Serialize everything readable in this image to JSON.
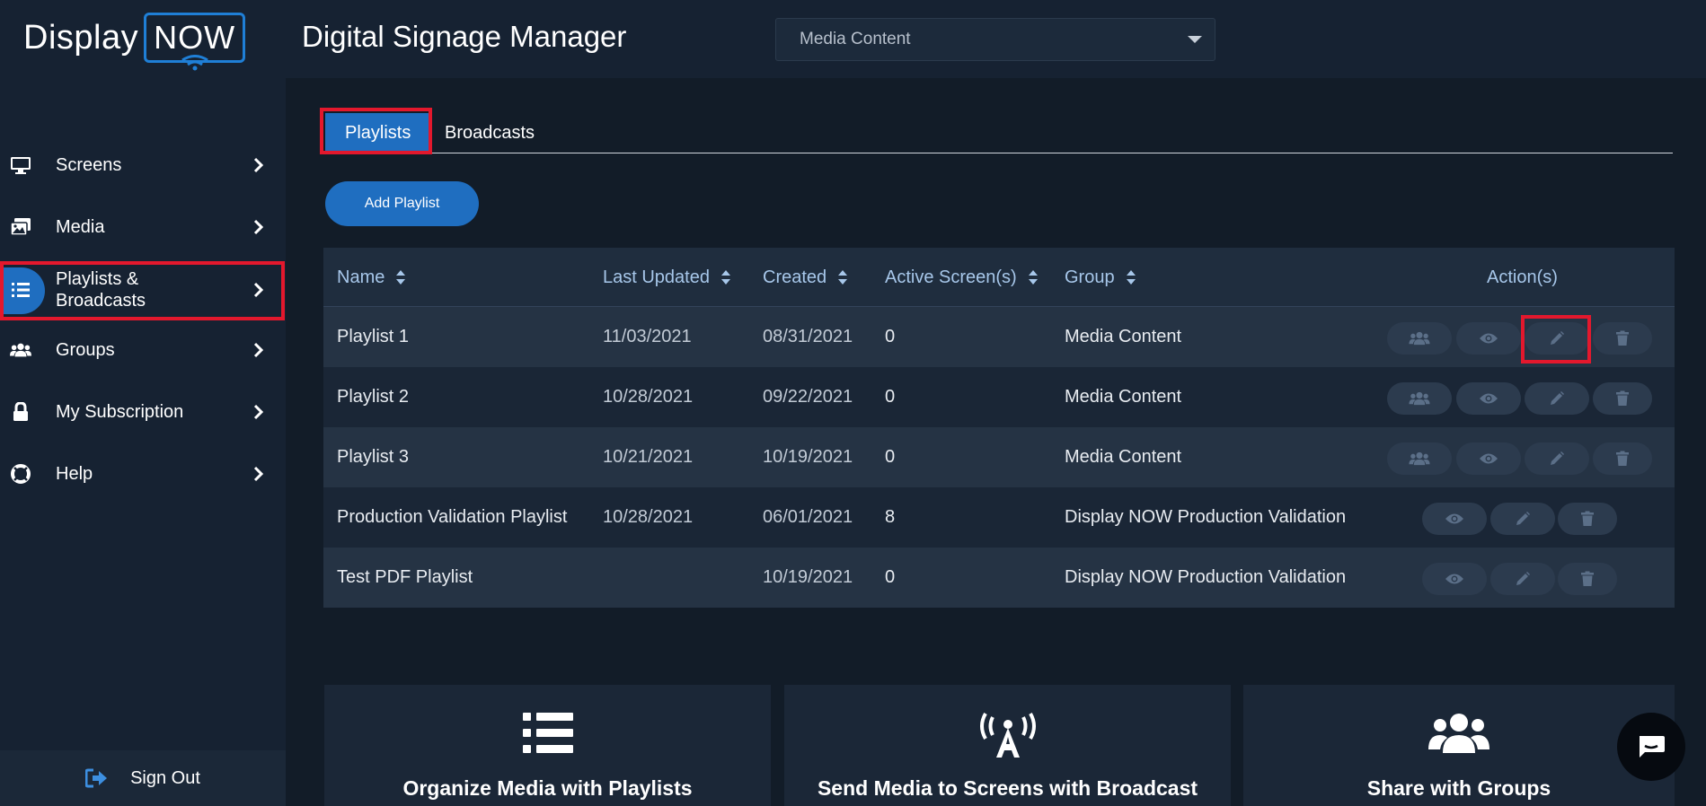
{
  "header": {
    "logo_part1": "Display",
    "logo_part2": "NOW",
    "app_title": "Digital Signage Manager",
    "group_select_value": "Media Content"
  },
  "sidebar": {
    "items": [
      {
        "label": "Screens",
        "icon": "monitor-icon"
      },
      {
        "label": "Media",
        "icon": "images-icon"
      },
      {
        "label": "Playlists & Broadcasts",
        "icon": "list-icon"
      },
      {
        "label": "Groups",
        "icon": "users-icon"
      },
      {
        "label": "My Subscription",
        "icon": "lock-icon"
      },
      {
        "label": "Help",
        "icon": "lifebuoy-icon"
      }
    ],
    "sign_out": "Sign Out"
  },
  "tabs": [
    {
      "label": "Playlists",
      "active": true
    },
    {
      "label": "Broadcasts",
      "active": false
    }
  ],
  "add_button": "Add Playlist",
  "table": {
    "columns": [
      "Name",
      "Last Updated",
      "Created",
      "Active Screen(s)",
      "Group",
      "Action(s)"
    ],
    "rows": [
      {
        "name": "Playlist 1",
        "last_updated": "11/03/2021",
        "created": "08/31/2021",
        "active_screens": "0",
        "group": "Media Content"
      },
      {
        "name": "Playlist 2",
        "last_updated": "10/28/2021",
        "created": "09/22/2021",
        "active_screens": "0",
        "group": "Media Content"
      },
      {
        "name": "Playlist 3",
        "last_updated": "10/21/2021",
        "created": "10/19/2021",
        "active_screens": "0",
        "group": "Media Content"
      },
      {
        "name": "Production Validation Playlist",
        "last_updated": "10/28/2021",
        "created": "06/01/2021",
        "active_screens": "8",
        "group": "Display NOW Production Validation"
      },
      {
        "name": "Test PDF Playlist",
        "last_updated": "",
        "created": "10/19/2021",
        "active_screens": "0",
        "group": "Display NOW Production Validation"
      }
    ]
  },
  "cards": [
    {
      "title": "Organize Media with Playlists",
      "icon": "list-icon"
    },
    {
      "title": "Send Media to Screens with Broadcast",
      "icon": "broadcast-tower-icon"
    },
    {
      "title": "Share with Groups",
      "icon": "users-icon"
    }
  ],
  "colors": {
    "accent": "#1f6ec0",
    "highlight": "#e3182d",
    "background": "#121c28"
  }
}
